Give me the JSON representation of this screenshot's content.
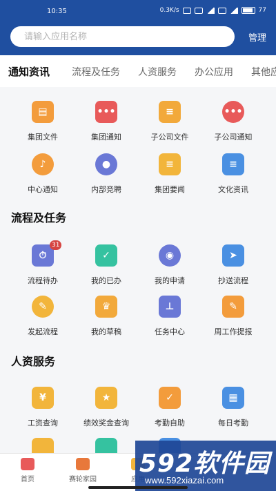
{
  "status": {
    "time": "10:35",
    "speed": "0.3K/s",
    "battery": "77"
  },
  "search": {
    "placeholder": "请输入应用名称",
    "manage_label": "管理"
  },
  "tabs": [
    "通知资讯",
    "流程及任务",
    "人资服务",
    "办公应用",
    "其他应"
  ],
  "sections": [
    {
      "title": "流程及任务"
    },
    {
      "title": "人资服务"
    }
  ],
  "apps": {
    "notice": [
      {
        "label": "集团文件",
        "icon": "folder-icon",
        "color": "#f39c3c"
      },
      {
        "label": "集团通知",
        "icon": "message-icon",
        "color": "#e85a5a"
      },
      {
        "label": "子公司文件",
        "icon": "document-icon",
        "color": "#f2a93b"
      },
      {
        "label": "子公司通知",
        "icon": "chat-bubble-icon",
        "color": "#e85a5a"
      },
      {
        "label": "中心通知",
        "icon": "bell-icon",
        "color": "#f39c3c"
      },
      {
        "label": "内部竞聘",
        "icon": "people-icon",
        "color": "#6a78d6"
      },
      {
        "label": "集团要闻",
        "icon": "note-icon",
        "color": "#f2b53b"
      },
      {
        "label": "文化资讯",
        "icon": "article-icon",
        "color": "#4a90e2"
      }
    ],
    "process": [
      {
        "label": "流程待办",
        "icon": "clock-play-icon",
        "color": "#6a78d6",
        "badge": "31"
      },
      {
        "label": "我的已办",
        "icon": "check-icon",
        "color": "#35c2a0"
      },
      {
        "label": "我的申请",
        "icon": "hub-icon",
        "color": "#6a78d6"
      },
      {
        "label": "抄送流程",
        "icon": "send-icon",
        "color": "#4a90e2"
      },
      {
        "label": "发起流程",
        "icon": "pen-icon",
        "color": "#f2b53b"
      },
      {
        "label": "我的草稿",
        "icon": "trophy-icon",
        "color": "#f2a93b"
      },
      {
        "label": "任务中心",
        "icon": "stamp-icon",
        "color": "#6a78d6"
      },
      {
        "label": "周工作提报",
        "icon": "edit-doc-icon",
        "color": "#f39c3c"
      }
    ],
    "hr": [
      {
        "label": "工资查询",
        "icon": "yuan-doc-icon",
        "color": "#f2b53b"
      },
      {
        "label": "绩效奖金查询",
        "icon": "star-icon",
        "color": "#f2b53b"
      },
      {
        "label": "考勤自助",
        "icon": "clipboard-check-icon",
        "color": "#f39c3c"
      },
      {
        "label": "每日考勤",
        "icon": "calendar-icon",
        "color": "#4a90e2"
      }
    ]
  },
  "bottom_nav": [
    {
      "label": "首页",
      "icon": "home-icon",
      "color": "#e85a5a"
    },
    {
      "label": "赛轮家园",
      "icon": "community-icon",
      "color": "#e8783b"
    },
    {
      "label": "应用",
      "icon": "apps-icon",
      "color": "#f2b53b"
    }
  ],
  "watermark": {
    "brand": "592软件园",
    "url": "www.592xiazai.com"
  }
}
